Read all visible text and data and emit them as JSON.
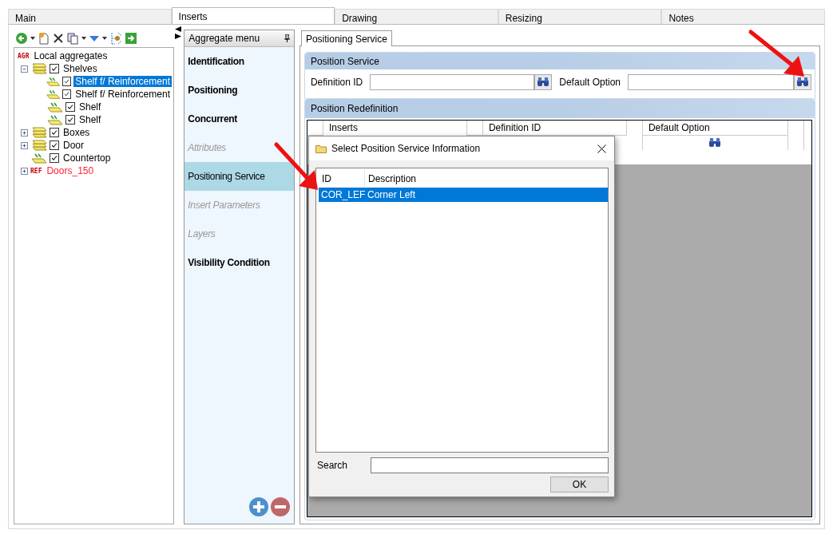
{
  "tabs": [
    {
      "label": "Main",
      "selected": false
    },
    {
      "label": "Inserts",
      "selected": true
    },
    {
      "label": "Drawing",
      "selected": false
    },
    {
      "label": "Resizing",
      "selected": false
    },
    {
      "label": "Notes",
      "selected": false
    }
  ],
  "tree": [
    {
      "label": "Local aggregates",
      "tag": "AGR",
      "kind": "root",
      "children": [
        {
          "label": "Shelves",
          "kind": "group",
          "checked": true,
          "expanded": true,
          "selected": false,
          "children": [
            {
              "label": "Shelf f/ Reinforcement",
              "kind": "item",
              "checked": true,
              "selected": true
            },
            {
              "label": "Shelf f/ Reinforcement",
              "kind": "item",
              "checked": true,
              "selected": false
            },
            {
              "label": "Shelf",
              "kind": "item",
              "checked": true,
              "selected": false
            },
            {
              "label": "Shelf",
              "kind": "item",
              "checked": true,
              "selected": false
            }
          ]
        },
        {
          "label": "Boxes",
          "kind": "group",
          "checked": true,
          "expanded": false,
          "selected": false
        },
        {
          "label": "Door",
          "kind": "group",
          "checked": true,
          "expanded": false,
          "selected": false
        },
        {
          "label": "Countertop",
          "kind": "item",
          "checked": true,
          "selected": false
        }
      ]
    },
    {
      "label": "Doors_150",
      "tag": "REF",
      "kind": "reference",
      "expanded": false
    }
  ],
  "aggregate_menu": {
    "title": "Aggregate menu",
    "items": [
      {
        "label": "Identification",
        "disabled": false,
        "selected": false
      },
      {
        "label": "Positioning",
        "disabled": false,
        "selected": false
      },
      {
        "label": "Concurrent",
        "disabled": false,
        "selected": false
      },
      {
        "label": "Attributes",
        "disabled": true,
        "selected": false
      },
      {
        "label": "Positioning Service",
        "disabled": false,
        "selected": true
      },
      {
        "label": "Insert Parameters",
        "disabled": true,
        "selected": false
      },
      {
        "label": "Layers",
        "disabled": true,
        "selected": false
      },
      {
        "label": "Visibility Condition",
        "disabled": false,
        "selected": false
      }
    ]
  },
  "inner_tab": {
    "label": "Positioning Service",
    "selected": true
  },
  "position_service": {
    "title": "Position Service",
    "fields": [
      {
        "label": "Definition ID"
      },
      {
        "label": "Default Option"
      }
    ]
  },
  "position_redefinition": {
    "title": "Position Redefinition",
    "columns": [
      "Inserts",
      "Definition ID",
      "Default Option"
    ]
  },
  "dialog": {
    "title": "Select Position Service Information",
    "columns": [
      "ID",
      "Description"
    ],
    "rows": [
      {
        "id": "COR_LEF",
        "description": "Corner Left",
        "selected": true
      }
    ],
    "search_label": "Search",
    "ok": "OK"
  }
}
